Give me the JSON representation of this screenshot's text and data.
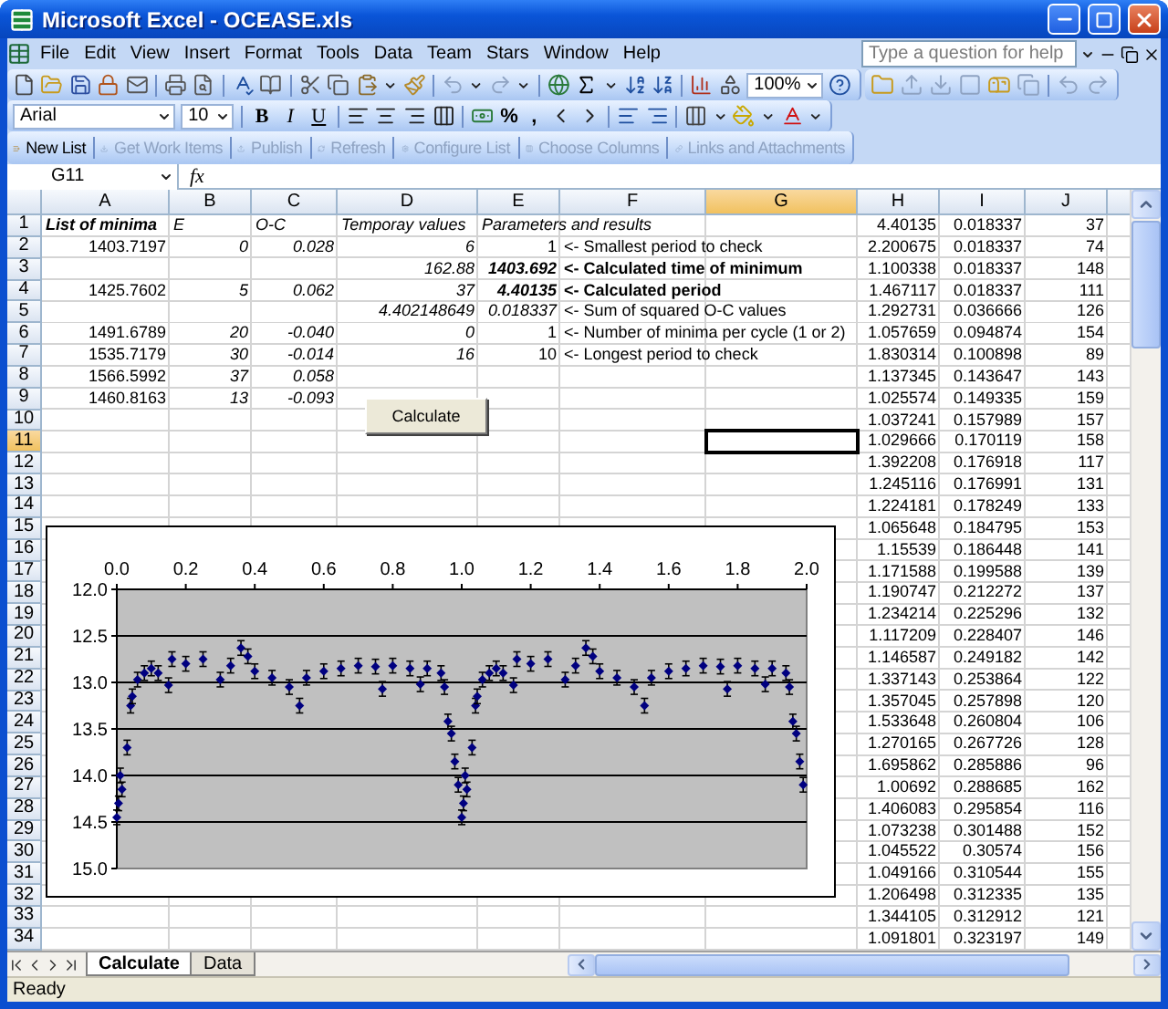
{
  "window": {
    "title": "Microsoft Excel - OCEASE.xls"
  },
  "menu": [
    "File",
    "Edit",
    "View",
    "Insert",
    "Format",
    "Tools",
    "Data",
    "Team",
    "Stars",
    "Window",
    "Help"
  ],
  "help_box": {
    "placeholder": "Type a question for help"
  },
  "standard_toolbar": {
    "zoom": "100%"
  },
  "formatting_toolbar": {
    "font": "Arial",
    "size": "10",
    "style_buttons": [
      {
        "label": "B",
        "kind": "bold"
      },
      {
        "label": "I",
        "kind": "italic"
      },
      {
        "label": "U",
        "kind": "underline"
      }
    ],
    "percent": "%",
    "comma": ","
  },
  "list_toolbar": [
    {
      "label": "New List",
      "disabled": false
    },
    {
      "label": "Get Work Items",
      "disabled": true
    },
    {
      "label": "Publish",
      "disabled": true
    },
    {
      "label": "Refresh",
      "disabled": true
    },
    {
      "label": "Configure List",
      "disabled": true
    },
    {
      "label": "Choose Columns",
      "disabled": true
    },
    {
      "label": "Links and Attachments",
      "disabled": true
    }
  ],
  "formula_bar": {
    "name_box": "G11",
    "fx": "fx"
  },
  "sheet": {
    "columns": [
      {
        "label": "A",
        "selected": false
      },
      {
        "label": "B",
        "selected": false
      },
      {
        "label": "C",
        "selected": false
      },
      {
        "label": "D",
        "selected": false
      },
      {
        "label": "E",
        "selected": false
      },
      {
        "label": "F",
        "selected": false
      },
      {
        "label": "G",
        "selected": true
      },
      {
        "label": "H",
        "selected": false
      },
      {
        "label": "I",
        "selected": false
      },
      {
        "label": "J",
        "selected": false
      }
    ],
    "rows": [
      {
        "label": "1",
        "selected": false,
        "cells": [
          {
            "t": "List of minima",
            "kind": "text",
            "bold": true,
            "italic": true
          },
          {
            "t": "E",
            "kind": "text",
            "bold": false,
            "italic": true
          },
          {
            "t": "O-C",
            "kind": "text",
            "bold": false,
            "italic": true
          },
          {
            "t": "Temporay values",
            "kind": "text",
            "bold": false,
            "italic": true
          },
          {
            "t": "Parameters and results",
            "kind": "text",
            "bold": false,
            "italic": true
          },
          null,
          null,
          "4.40135",
          "0.018337",
          "37"
        ]
      },
      {
        "label": "2",
        "selected": false,
        "cells": [
          {
            "t": "1403.7197",
            "kind": "num",
            "bold": false,
            "italic": false
          },
          {
            "t": "0",
            "kind": "num",
            "bold": false,
            "italic": true
          },
          {
            "t": "0.028",
            "kind": "num",
            "bold": false,
            "italic": true
          },
          {
            "t": "6",
            "kind": "num",
            "bold": false,
            "italic": true
          },
          {
            "t": "1",
            "kind": "num",
            "bold": false,
            "italic": false
          },
          {
            "t": "<- Smallest period to check",
            "kind": "text",
            "bold": false,
            "italic": false
          },
          null,
          "2.200675",
          "0.018337",
          "74"
        ]
      },
      {
        "label": "3",
        "selected": false,
        "cells": [
          null,
          null,
          null,
          {
            "t": "162.88",
            "kind": "num",
            "bold": false,
            "italic": true
          },
          {
            "t": "1403.692",
            "kind": "num",
            "bold": true,
            "italic": true
          },
          {
            "t": "<- Calculated time of minimum",
            "kind": "text",
            "bold": true,
            "italic": false
          },
          null,
          "1.100338",
          "0.018337",
          "148"
        ]
      },
      {
        "label": "4",
        "selected": false,
        "cells": [
          {
            "t": "1425.7602",
            "kind": "num",
            "bold": false,
            "italic": false
          },
          {
            "t": "5",
            "kind": "num",
            "bold": false,
            "italic": true
          },
          {
            "t": "0.062",
            "kind": "num",
            "bold": false,
            "italic": true
          },
          {
            "t": "37",
            "kind": "num",
            "bold": false,
            "italic": true
          },
          {
            "t": "4.40135",
            "kind": "num",
            "bold": true,
            "italic": true
          },
          {
            "t": "<- Calculated period",
            "kind": "text",
            "bold": true,
            "italic": false
          },
          null,
          "1.467117",
          "0.018337",
          "111"
        ]
      },
      {
        "label": "5",
        "selected": false,
        "cells": [
          null,
          null,
          null,
          {
            "t": "4.402148649",
            "kind": "num",
            "bold": false,
            "italic": true
          },
          {
            "t": "0.018337",
            "kind": "num",
            "bold": false,
            "italic": true
          },
          {
            "t": "<- Sum of squared O-C values",
            "kind": "text",
            "bold": false,
            "italic": false
          },
          null,
          "1.292731",
          "0.036666",
          "126"
        ]
      },
      {
        "label": "6",
        "selected": false,
        "cells": [
          {
            "t": "1491.6789",
            "kind": "num",
            "bold": false,
            "italic": false
          },
          {
            "t": "20",
            "kind": "num",
            "bold": false,
            "italic": true
          },
          {
            "t": "-0.040",
            "kind": "num",
            "bold": false,
            "italic": true
          },
          {
            "t": "0",
            "kind": "num",
            "bold": false,
            "italic": true
          },
          {
            "t": "1",
            "kind": "num",
            "bold": false,
            "italic": false
          },
          {
            "t": "<- Number of minima per cycle (1 or 2)",
            "kind": "text",
            "bold": false,
            "italic": false
          },
          null,
          "1.057659",
          "0.094874",
          "154"
        ]
      },
      {
        "label": "7",
        "selected": false,
        "cells": [
          {
            "t": "1535.7179",
            "kind": "num",
            "bold": false,
            "italic": false
          },
          {
            "t": "30",
            "kind": "num",
            "bold": false,
            "italic": true
          },
          {
            "t": "-0.014",
            "kind": "num",
            "bold": false,
            "italic": true
          },
          {
            "t": "16",
            "kind": "num",
            "bold": false,
            "italic": true
          },
          {
            "t": "10",
            "kind": "num",
            "bold": false,
            "italic": false
          },
          {
            "t": "<- Longest period to check",
            "kind": "text",
            "bold": false,
            "italic": false
          },
          null,
          "1.830314",
          "0.100898",
          "89"
        ]
      },
      {
        "label": "8",
        "selected": false,
        "cells": [
          {
            "t": "1566.5992",
            "kind": "num",
            "bold": false,
            "italic": false
          },
          {
            "t": "37",
            "kind": "num",
            "bold": false,
            "italic": true
          },
          {
            "t": "0.058",
            "kind": "num",
            "bold": false,
            "italic": true
          },
          null,
          null,
          null,
          null,
          "1.137345",
          "0.143647",
          "143"
        ]
      },
      {
        "label": "9",
        "selected": false,
        "cells": [
          {
            "t": "1460.8163",
            "kind": "num",
            "bold": false,
            "italic": false
          },
          {
            "t": "13",
            "kind": "num",
            "bold": false,
            "italic": true
          },
          {
            "t": "-0.093",
            "kind": "num",
            "bold": false,
            "italic": true
          },
          null,
          null,
          null,
          null,
          "1.025574",
          "0.149335",
          "159"
        ]
      },
      {
        "label": "10",
        "selected": false,
        "cells": [
          null,
          null,
          null,
          null,
          null,
          null,
          null,
          "1.037241",
          "0.157989",
          "157"
        ]
      },
      {
        "label": "11",
        "selected": true,
        "cells": [
          null,
          null,
          null,
          null,
          null,
          null,
          null,
          "1.029666",
          "0.170119",
          "158"
        ]
      },
      {
        "label": "12",
        "selected": false,
        "cells": [
          null,
          null,
          null,
          null,
          null,
          null,
          null,
          "1.392208",
          "0.176918",
          "117"
        ]
      },
      {
        "label": "13",
        "selected": false,
        "cells": [
          null,
          null,
          null,
          null,
          null,
          null,
          null,
          "1.245116",
          "0.176991",
          "131"
        ]
      },
      {
        "label": "14",
        "selected": false,
        "cells": [
          null,
          null,
          null,
          null,
          null,
          null,
          null,
          "1.224181",
          "0.178249",
          "133"
        ]
      },
      {
        "label": "15",
        "selected": false,
        "cells": [
          null,
          null,
          null,
          null,
          null,
          null,
          null,
          "1.065648",
          "0.184795",
          "153"
        ]
      },
      {
        "label": "16",
        "selected": false,
        "cells": [
          null,
          null,
          null,
          null,
          null,
          null,
          null,
          "1.15539",
          "0.186448",
          "141"
        ]
      },
      {
        "label": "17",
        "selected": false,
        "cells": [
          null,
          null,
          null,
          null,
          null,
          null,
          null,
          "1.171588",
          "0.199588",
          "139"
        ]
      },
      {
        "label": "18",
        "selected": false,
        "cells": [
          null,
          null,
          null,
          null,
          null,
          null,
          null,
          "1.190747",
          "0.212272",
          "137"
        ]
      },
      {
        "label": "19",
        "selected": false,
        "cells": [
          null,
          null,
          null,
          null,
          null,
          null,
          null,
          "1.234214",
          "0.225296",
          "132"
        ]
      },
      {
        "label": "20",
        "selected": false,
        "cells": [
          null,
          null,
          null,
          null,
          null,
          null,
          null,
          "1.117209",
          "0.228407",
          "146"
        ]
      },
      {
        "label": "21",
        "selected": false,
        "cells": [
          null,
          null,
          null,
          null,
          null,
          null,
          null,
          "1.146587",
          "0.249182",
          "142"
        ]
      },
      {
        "label": "22",
        "selected": false,
        "cells": [
          null,
          null,
          null,
          null,
          null,
          null,
          null,
          "1.337143",
          "0.253864",
          "122"
        ]
      },
      {
        "label": "23",
        "selected": false,
        "cells": [
          null,
          null,
          null,
          null,
          null,
          null,
          null,
          "1.357045",
          "0.257898",
          "120"
        ]
      },
      {
        "label": "24",
        "selected": false,
        "cells": [
          null,
          null,
          null,
          null,
          null,
          null,
          null,
          "1.533648",
          "0.260804",
          "106"
        ]
      },
      {
        "label": "25",
        "selected": false,
        "cells": [
          null,
          null,
          null,
          null,
          null,
          null,
          null,
          "1.270165",
          "0.267726",
          "128"
        ]
      },
      {
        "label": "26",
        "selected": false,
        "cells": [
          null,
          null,
          null,
          null,
          null,
          null,
          null,
          "1.695862",
          "0.285886",
          "96"
        ]
      },
      {
        "label": "27",
        "selected": false,
        "cells": [
          null,
          null,
          null,
          null,
          null,
          null,
          null,
          "1.00692",
          "0.288685",
          "162"
        ]
      },
      {
        "label": "28",
        "selected": false,
        "cells": [
          null,
          null,
          null,
          null,
          null,
          null,
          null,
          "1.406083",
          "0.295854",
          "116"
        ]
      },
      {
        "label": "29",
        "selected": false,
        "cells": [
          null,
          null,
          null,
          null,
          null,
          null,
          null,
          "1.073238",
          "0.301488",
          "152"
        ]
      },
      {
        "label": "30",
        "selected": false,
        "cells": [
          null,
          null,
          null,
          null,
          null,
          null,
          null,
          "1.045522",
          "0.30574",
          "156"
        ]
      },
      {
        "label": "31",
        "selected": false,
        "cells": [
          null,
          null,
          null,
          null,
          null,
          null,
          null,
          "1.049166",
          "0.310544",
          "155"
        ]
      },
      {
        "label": "32",
        "selected": false,
        "cells": [
          null,
          null,
          null,
          null,
          null,
          null,
          null,
          "1.206498",
          "0.312335",
          "135"
        ]
      },
      {
        "label": "33",
        "selected": false,
        "cells": [
          null,
          null,
          null,
          null,
          null,
          null,
          null,
          "1.344105",
          "0.312912",
          "121"
        ]
      },
      {
        "label": "34",
        "selected": false,
        "cells": [
          null,
          null,
          null,
          null,
          null,
          null,
          null,
          "1.091801",
          "0.323197",
          "149"
        ]
      }
    ],
    "button": {
      "label": "Calculate"
    },
    "chart_data": {
      "type": "scatter",
      "x": [
        0,
        0.005,
        0.01,
        0.015,
        0.03,
        0.04,
        0.045,
        0.06,
        0.08,
        0.1,
        0.12,
        0.15,
        0.16,
        0.2,
        0.25,
        0.3,
        0.33,
        0.36,
        0.38,
        0.4,
        0.45,
        0.5,
        0.53,
        0.55,
        0.6,
        0.65,
        0.7,
        0.75,
        0.77,
        0.8,
        0.85,
        0.88,
        0.9,
        0.94,
        0.95,
        0.96,
        0.97,
        0.98,
        0.99,
        1,
        1.005,
        1.01,
        1.015,
        1.03,
        1.04,
        1.045,
        1.06,
        1.08,
        1.1,
        1.12,
        1.15,
        1.16,
        1.2,
        1.25,
        1.3,
        1.33,
        1.36,
        1.38,
        1.4,
        1.45,
        1.5,
        1.53,
        1.55,
        1.6,
        1.65,
        1.7,
        1.75,
        1.77,
        1.8,
        1.85,
        1.88,
        1.9,
        1.94,
        1.95,
        1.96,
        1.97,
        1.98,
        1.99
      ],
      "series": [
        {
          "color": "#000080",
          "values": [
            14.45,
            14.3,
            14.0,
            14.15,
            13.7,
            13.25,
            13.15,
            12.97,
            12.9,
            12.85,
            12.9,
            13.03,
            12.75,
            12.8,
            12.75,
            12.97,
            12.82,
            12.63,
            12.72,
            12.88,
            12.95,
            13.05,
            13.25,
            12.95,
            12.88,
            12.85,
            12.82,
            12.83,
            13.07,
            12.82,
            12.85,
            13.02,
            12.85,
            12.9,
            13.05,
            13.42,
            13.55,
            13.85,
            14.1,
            14.45,
            14.3,
            14.0,
            14.15,
            13.7,
            13.25,
            13.15,
            12.97,
            12.9,
            12.85,
            12.9,
            13.03,
            12.75,
            12.8,
            12.75,
            12.97,
            12.82,
            12.63,
            12.72,
            12.88,
            12.95,
            13.05,
            13.25,
            12.95,
            12.88,
            12.85,
            12.82,
            12.83,
            13.07,
            12.82,
            12.85,
            13.02,
            12.85,
            12.9,
            13.05,
            13.42,
            13.55,
            13.85,
            14.1
          ]
        }
      ],
      "xlim": [
        0,
        2
      ],
      "ylim": [
        15,
        12
      ],
      "grid": true,
      "xticks": [
        {
          "value": 0,
          "label": "0.0"
        },
        {
          "value": 0.2,
          "label": "0.2"
        },
        {
          "value": 0.4,
          "label": "0.4"
        },
        {
          "value": 0.6,
          "label": "0.6"
        },
        {
          "value": 0.8,
          "label": "0.8"
        },
        {
          "value": 1,
          "label": "1.0"
        },
        {
          "value": 1.2,
          "label": "1.2"
        },
        {
          "value": 1.4,
          "label": "1.4"
        },
        {
          "value": 1.6,
          "label": "1.6"
        },
        {
          "value": 1.8,
          "label": "1.8"
        },
        {
          "value": 2,
          "label": "2.0"
        }
      ],
      "yticks": [
        {
          "value": 12,
          "label": "12.0"
        },
        {
          "value": 12.5,
          "label": "12.5"
        },
        {
          "value": 13,
          "label": "13.0"
        },
        {
          "value": 13.5,
          "label": "13.5"
        },
        {
          "value": 14,
          "label": "14.0"
        },
        {
          "value": 14.5,
          "label": "14.5"
        },
        {
          "value": 15,
          "label": "15.0"
        }
      ]
    }
  },
  "sheet_tabs": [
    {
      "label": "Calculate",
      "selected": true
    },
    {
      "label": "Data",
      "selected": false
    }
  ],
  "status_bar": {
    "text": "Ready"
  }
}
